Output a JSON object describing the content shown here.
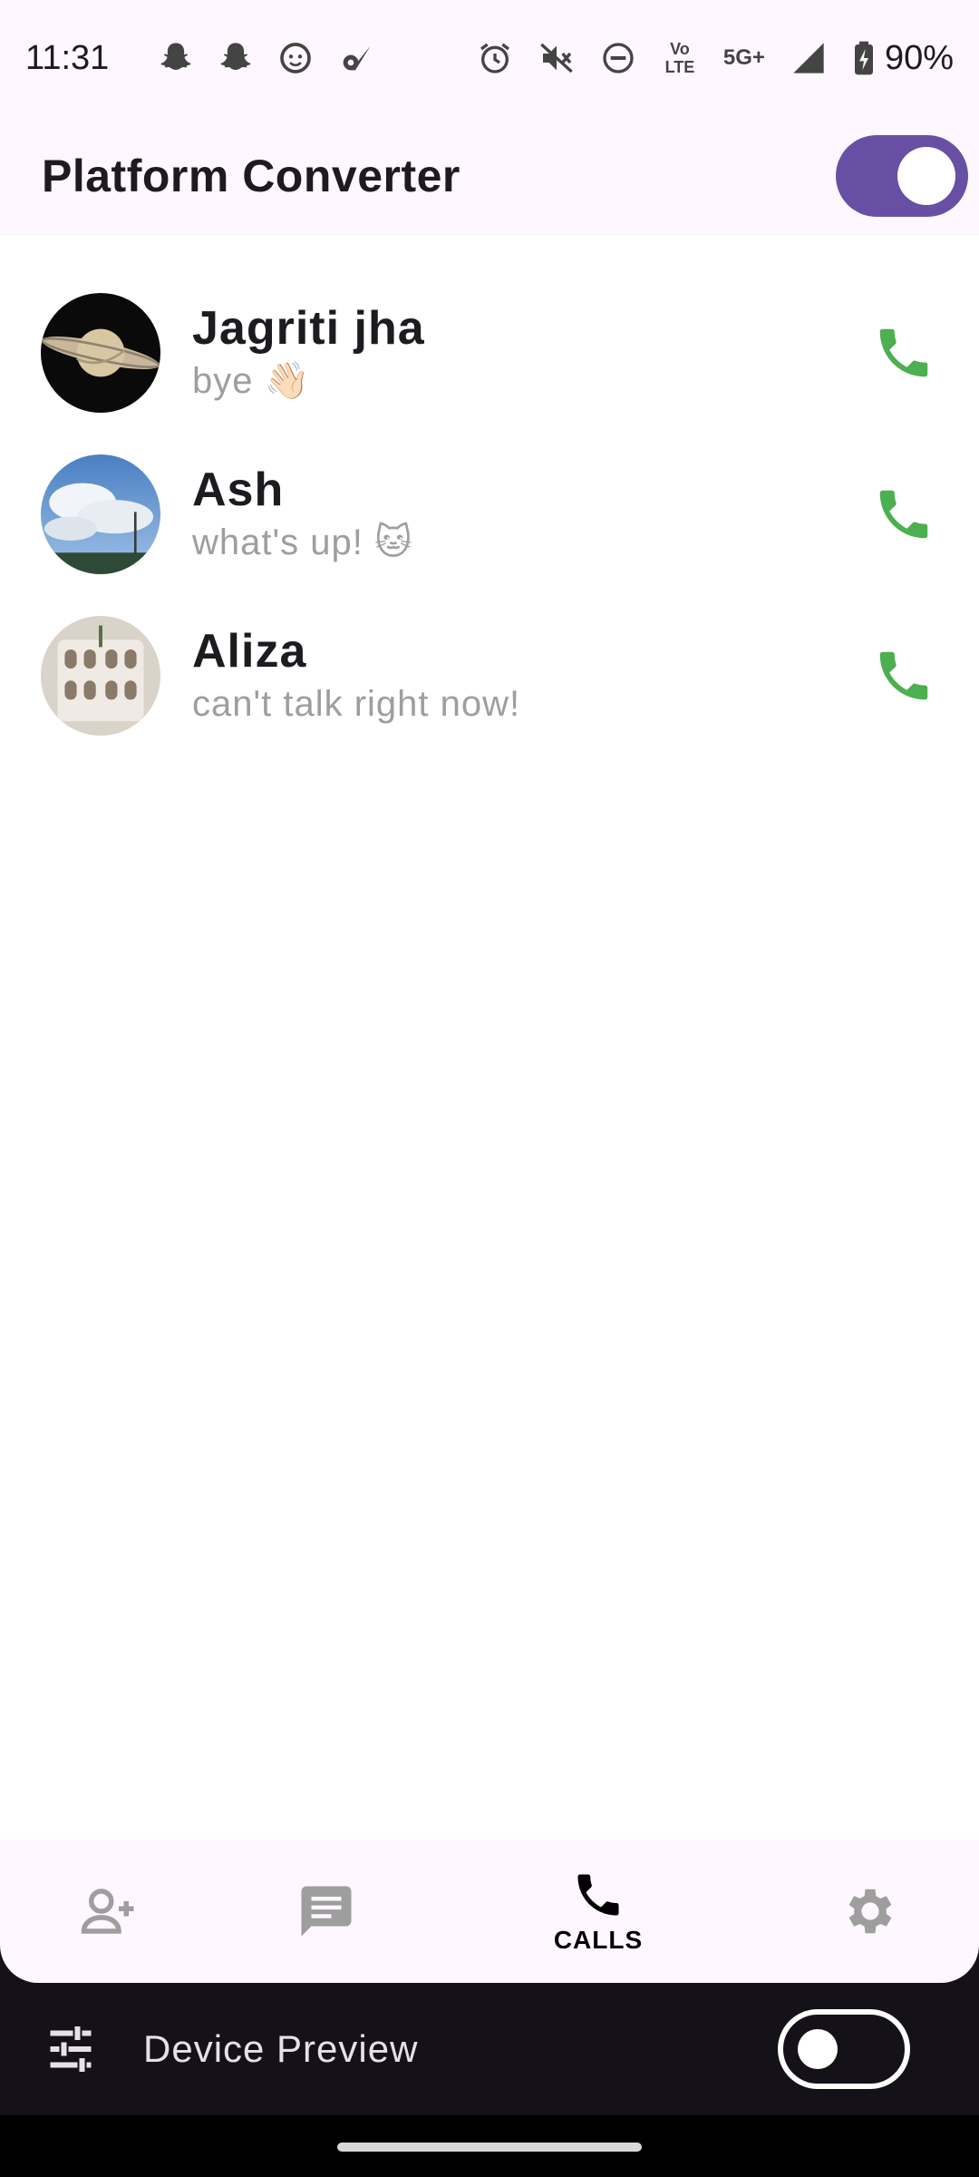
{
  "status_bar": {
    "time": "11:31",
    "network": "5G+",
    "volte": "Vo LTE",
    "battery": "90%"
  },
  "app_bar": {
    "title": "Platform Converter",
    "toggle_on": true
  },
  "calls": [
    {
      "name": "Jagriti jha",
      "message": "bye 👋🏻",
      "avatar": "saturn"
    },
    {
      "name": "Ash",
      "message": "what's up! 🐱",
      "avatar": "sky"
    },
    {
      "name": "Aliza",
      "message": "can't talk right now!",
      "avatar": "shelves"
    }
  ],
  "bottom_nav": {
    "items": [
      {
        "id": "add-contact",
        "icon": "person-add-icon",
        "label": ""
      },
      {
        "id": "chats",
        "icon": "chat-icon",
        "label": ""
      },
      {
        "id": "calls",
        "icon": "phone-icon",
        "label": "CALLS",
        "active": true
      },
      {
        "id": "settings",
        "icon": "gear-icon",
        "label": ""
      }
    ]
  },
  "device_preview": {
    "label": "Device Preview",
    "enabled": false
  },
  "colors": {
    "primary": "#6750a4",
    "surface": "#fef7ff",
    "call_green": "#4caf50",
    "muted_text": "#9e9e9e",
    "nav_inactive": "#9e9e9e",
    "device_bar": "#141218"
  }
}
